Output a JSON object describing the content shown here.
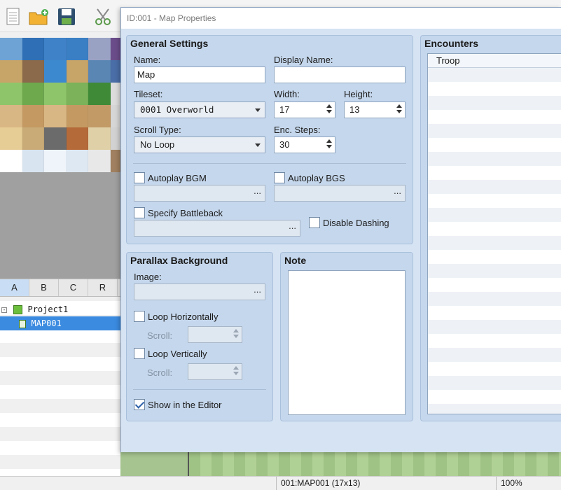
{
  "editor": {
    "tile_colors": [
      "#6ea3d6",
      "#2e6fb5",
      "#3f82c8",
      "#3a7fc4",
      "#9aa2c4",
      "#6b4c8a",
      "#c7a468",
      "#8a6a4a",
      "#3d89d0",
      "#c7a468",
      "#5a86b4",
      "#4a6ea8",
      "#8fc56a",
      "#6ea94e",
      "#8fc56a",
      "#7bb25a",
      "#3f8a36",
      "#dcdcdc",
      "#d9b784",
      "#c49a62",
      "#d9b784",
      "#c49a62",
      "#c29a66",
      "#d6d6d6",
      "#e6cc95",
      "#c9ab77",
      "#6b6b6b",
      "#b56a3a",
      "#e0d0a8",
      "#d2d2d2",
      "#ffffff",
      "#d8e4f0",
      "#eef4fa",
      "#dde8f3",
      "#e8e8e8",
      "#a08060"
    ],
    "tabs": [
      "A",
      "B",
      "C",
      "R"
    ],
    "tree": {
      "project": "Project1",
      "map": "MAP001"
    },
    "status": {
      "map_info": "001:MAP001 (17x13)",
      "zoom": "100%"
    }
  },
  "dialog": {
    "title": "ID:001 - Map Properties",
    "general": {
      "heading": "General Settings",
      "name_label": "Name:",
      "name_value": "Map",
      "display_name_label": "Display Name:",
      "display_name_value": "",
      "tileset_label": "Tileset:",
      "tileset_value": "0001 Overworld",
      "width_label": "Width:",
      "width_value": "17",
      "height_label": "Height:",
      "height_value": "13",
      "scroll_type_label": "Scroll Type:",
      "scroll_type_value": "No Loop",
      "enc_steps_label": "Enc. Steps:",
      "enc_steps_value": "30",
      "autoplay_bgm_label": "Autoplay BGM",
      "autoplay_bgm_checked": false,
      "autoplay_bgs_label": "Autoplay BGS",
      "autoplay_bgs_checked": false,
      "specify_battleback_label": "Specify Battleback",
      "specify_battleback_checked": false,
      "disable_dashing_label": "Disable Dashing",
      "disable_dashing_checked": false,
      "ellipsis": "..."
    },
    "parallax": {
      "heading": "Parallax Background",
      "image_label": "Image:",
      "loop_horizontally_label": "Loop Horizontally",
      "loop_horizontally_checked": false,
      "loop_vertically_label": "Loop Vertically",
      "loop_vertically_checked": false,
      "scroll_label": "Scroll:",
      "show_in_editor_label": "Show in the Editor",
      "show_in_editor_checked": true
    },
    "note": {
      "heading": "Note",
      "value": ""
    },
    "encounters": {
      "heading": "Encounters",
      "column_troop": "Troop"
    }
  }
}
